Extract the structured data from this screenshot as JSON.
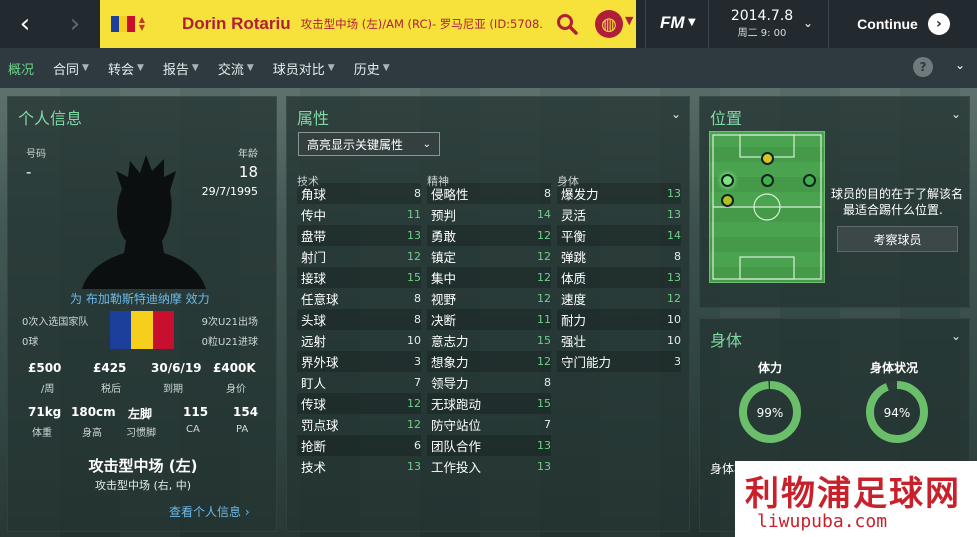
{
  "topbar": {
    "player_name": "Dorin Rotariu",
    "player_info": "攻击型中场 (左)/AM (RC)- 罗马尼亚 (ID:5708...",
    "date": "2014.7.8",
    "weekday_time": "周二 9: 00",
    "continue_label": "Continue",
    "fm_logo": "FM"
  },
  "menu": {
    "items": [
      "概况",
      "合同",
      "转会",
      "报告",
      "交流",
      "球员对比",
      "历史"
    ],
    "help": "?"
  },
  "personal": {
    "title": "个人信息",
    "number_label": "号码",
    "number_value": "-",
    "age_label": "年龄",
    "age_value": "18",
    "dob": "29/7/1995",
    "plays_for": "为 布加勒斯特迪纳摩 效力",
    "caps": "0次入选国家队",
    "goals": "0球",
    "u21_apps": "9次U21出场",
    "u21_goals": "0粒U21进球",
    "wage": "£500",
    "wage_label": "/周",
    "after_tax": "£425",
    "after_tax_label": "税后",
    "expires": "30/6/19",
    "expires_label": "到期",
    "value": "£400K",
    "value_label": "身价",
    "weight": "71kg",
    "weight_label": "体重",
    "height": "180cm",
    "height_label": "身高",
    "foot": "左脚",
    "foot_label": "习惯脚",
    "ca": "115",
    "ca_label": "CA",
    "pa": "154",
    "pa_label": "PA",
    "position_main": "攻击型中场 (左)",
    "position_sub": "攻击型中场 (右, 中)",
    "view_link": "查看个人信息 ›"
  },
  "attributes": {
    "title": "属性",
    "dropdown": "高亮显示关键属性",
    "technical_header": "技术",
    "mental_header": "精神",
    "physical_header": "身体",
    "technical": [
      {
        "name": "角球",
        "value": "8"
      },
      {
        "name": "传中",
        "value": "11"
      },
      {
        "name": "盘带",
        "value": "13"
      },
      {
        "name": "射门",
        "value": "12"
      },
      {
        "name": "接球",
        "value": "15"
      },
      {
        "name": "任意球",
        "value": "8"
      },
      {
        "name": "头球",
        "value": "8"
      },
      {
        "name": "远射",
        "value": "10"
      },
      {
        "name": "界外球",
        "value": "3"
      },
      {
        "name": "盯人",
        "value": "7"
      },
      {
        "name": "传球",
        "value": "12"
      },
      {
        "name": "罚点球",
        "value": "12"
      },
      {
        "name": "抢断",
        "value": "6"
      },
      {
        "name": "技术",
        "value": "13"
      }
    ],
    "mental": [
      {
        "name": "侵略性",
        "value": "8"
      },
      {
        "name": "预判",
        "value": "14"
      },
      {
        "name": "勇敢",
        "value": "12"
      },
      {
        "name": "镇定",
        "value": "12"
      },
      {
        "name": "集中",
        "value": "12"
      },
      {
        "name": "视野",
        "value": "12"
      },
      {
        "name": "决断",
        "value": "11"
      },
      {
        "name": "意志力",
        "value": "15"
      },
      {
        "name": "想象力",
        "value": "12"
      },
      {
        "name": "领导力",
        "value": "8"
      },
      {
        "name": "无球跑动",
        "value": "15"
      },
      {
        "name": "防守站位",
        "value": "7"
      },
      {
        "name": "团队合作",
        "value": "13"
      },
      {
        "name": "工作投入",
        "value": "13"
      }
    ],
    "physical": [
      {
        "name": "爆发力",
        "value": "13"
      },
      {
        "name": "灵活",
        "value": "13"
      },
      {
        "name": "平衡",
        "value": "14"
      },
      {
        "name": "弹跳",
        "value": "8"
      },
      {
        "name": "体质",
        "value": "13"
      },
      {
        "name": "速度",
        "value": "12"
      },
      {
        "name": "耐力",
        "value": "10"
      },
      {
        "name": "强壮",
        "value": "10"
      },
      {
        "name": "守门能力",
        "value": "3"
      }
    ]
  },
  "position": {
    "title": "位置",
    "desc_line1": "球员的目的在于了解该名",
    "desc_line2": "最适合踢什么位置.",
    "scout_button": "考察球员"
  },
  "physical": {
    "title": "身体",
    "stamina_label": "体力",
    "stamina_value": "99%",
    "stamina_fraction": 0.99,
    "condition_label": "身体状况",
    "condition_value": "94%",
    "condition_fraction": 0.94,
    "fitness_label": "身体状况信息"
  },
  "watermark": {
    "line1": "利物浦足球网",
    "line2": "liwupuba.com"
  },
  "colors": {
    "accent_green": "#7fd9a3",
    "highlight_yellow": "#f6e23a",
    "name_red": "#b01e3a",
    "value_green": "#6fd08a",
    "link_blue": "#6db8e8"
  }
}
